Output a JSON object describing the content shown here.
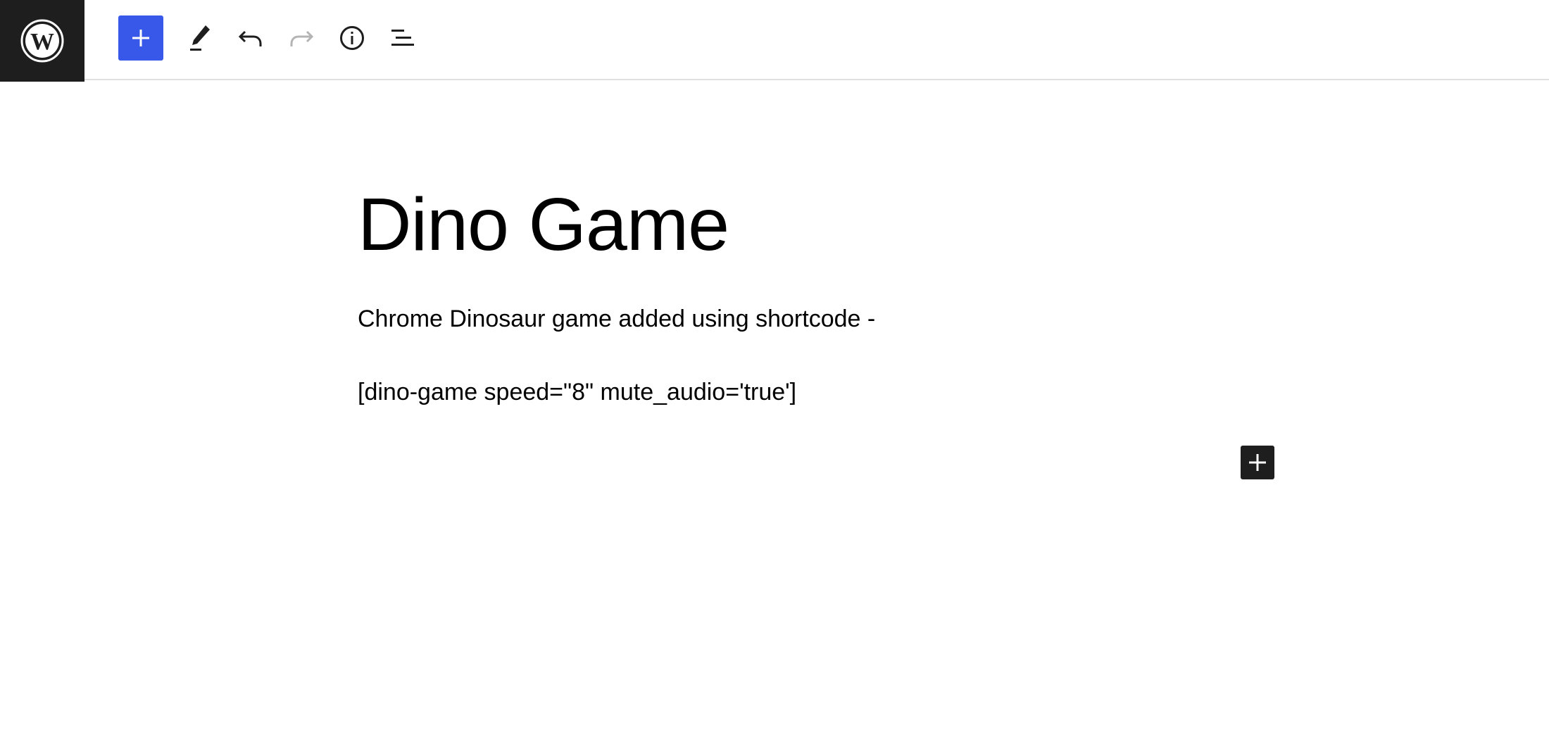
{
  "toolbar": {
    "logo_icon": "wordpress-logo-icon",
    "tools": [
      {
        "name": "toggle-block-inserter",
        "icon": "plus-icon"
      },
      {
        "name": "tools",
        "icon": "pencil-icon"
      },
      {
        "name": "undo",
        "icon": "undo-icon"
      },
      {
        "name": "redo",
        "icon": "redo-icon",
        "disabled": true
      },
      {
        "name": "details",
        "icon": "info-icon"
      },
      {
        "name": "document-overview",
        "icon": "list-view-icon"
      }
    ],
    "accent_color": "#3858e9"
  },
  "post": {
    "title": "Dino Game",
    "paragraphs": [
      "Chrome Dinosaur game added using shortcode -",
      "[dino-game speed=\"8\" mute_audio='true']"
    ]
  },
  "block_appender": {
    "icon": "plus-icon"
  }
}
